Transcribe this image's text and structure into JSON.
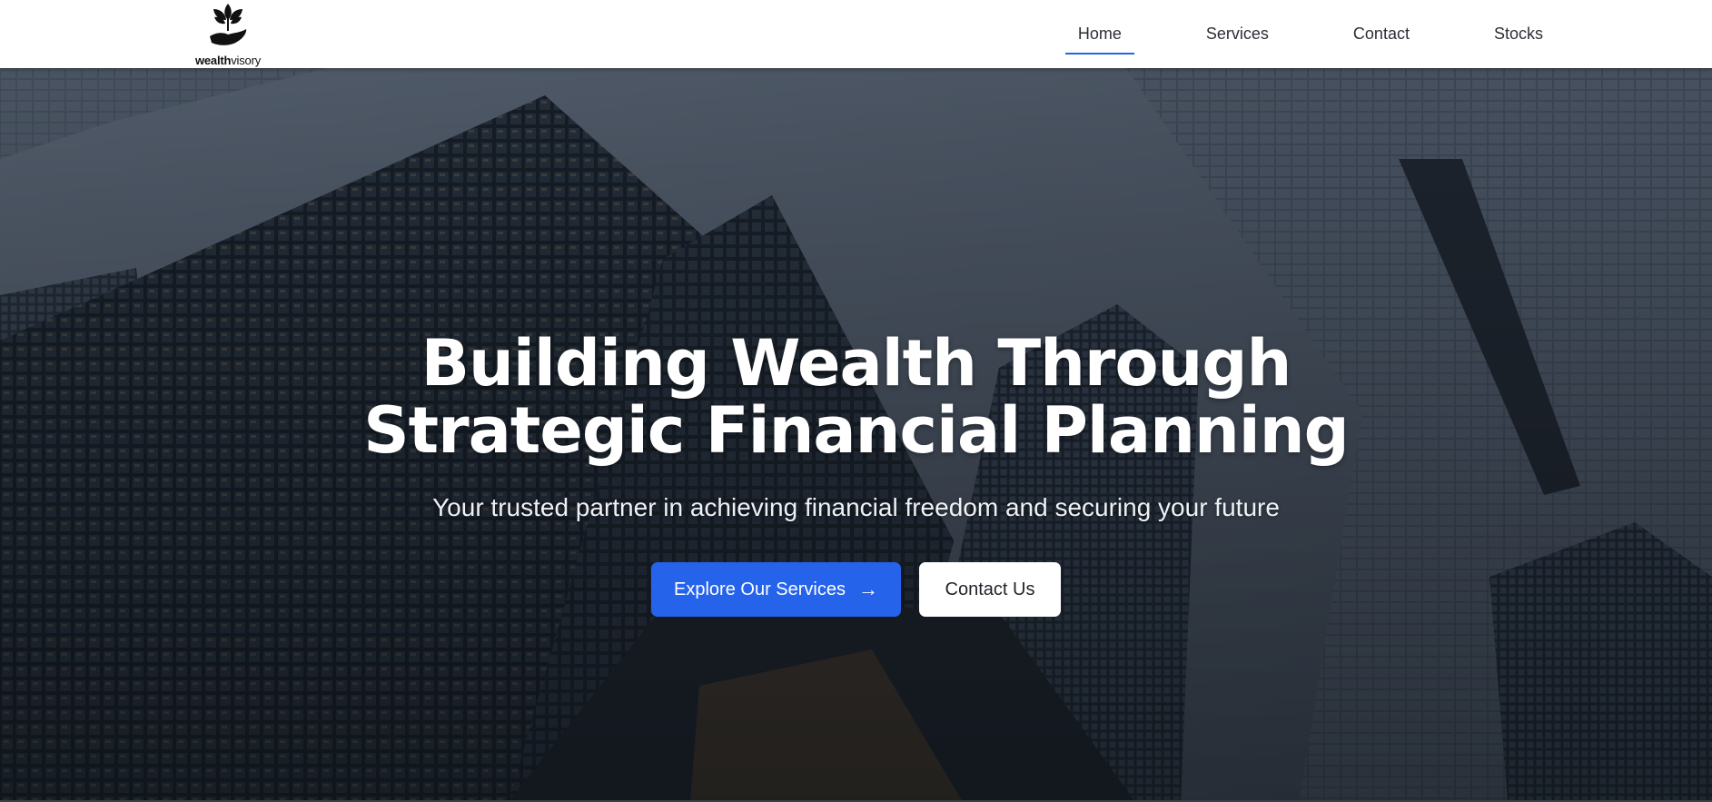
{
  "brand": {
    "name_bold": "wealth",
    "name_light": "visory"
  },
  "nav": {
    "items": [
      {
        "label": "Home",
        "active": true
      },
      {
        "label": "Services",
        "active": false
      },
      {
        "label": "Contact",
        "active": false
      },
      {
        "label": "Stocks",
        "active": false
      }
    ]
  },
  "hero": {
    "headline_line1": "Building Wealth Through",
    "headline_line2": "Strategic Financial Planning",
    "subtitle": "Your trusted partner in achieving financial freedom and securing your future",
    "primary_button": "Explore Our Services",
    "primary_button_icon": "arrow-right-icon",
    "secondary_button": "Contact Us",
    "background_image": "skyscrapers-looking-up"
  },
  "colors": {
    "accent": "#2563eb",
    "nav_text": "#2b2f36",
    "headline": "#ffffff"
  }
}
